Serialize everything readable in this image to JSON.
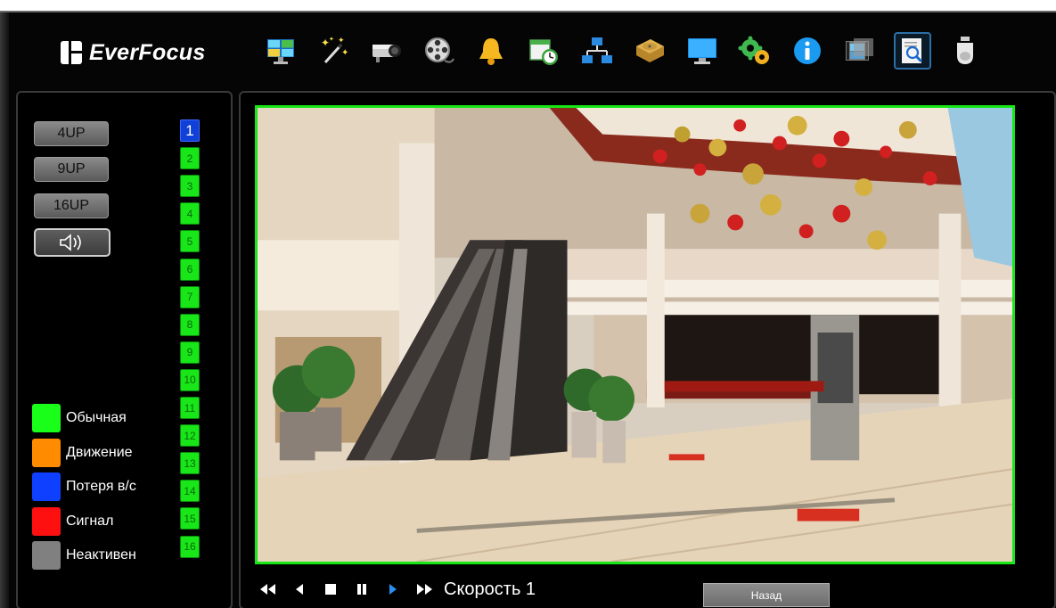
{
  "brand": {
    "name": "EverFocus"
  },
  "toolbar": {
    "icons": [
      {
        "name": "live-view-icon"
      },
      {
        "name": "wizard-icon"
      },
      {
        "name": "camera-icon"
      },
      {
        "name": "record-reel-icon"
      },
      {
        "name": "alarm-bell-icon"
      },
      {
        "name": "schedule-icon"
      },
      {
        "name": "network-icon"
      },
      {
        "name": "hdd-icon"
      },
      {
        "name": "display-icon"
      },
      {
        "name": "system-settings-icon"
      },
      {
        "name": "info-icon"
      },
      {
        "name": "playback-icon"
      },
      {
        "name": "search-icon",
        "active": true
      },
      {
        "name": "ptz-dome-icon"
      }
    ]
  },
  "layouts": {
    "btn_4": "4UP",
    "btn_9": "9UP",
    "btn_16": "16UP"
  },
  "channels": [
    "1",
    "2",
    "3",
    "4",
    "5",
    "6",
    "7",
    "8",
    "9",
    "10",
    "11",
    "12",
    "13",
    "14",
    "15",
    "16"
  ],
  "selected_channel": "1",
  "legend": [
    {
      "label": "Обычная",
      "color": "#19ff19"
    },
    {
      "label": "Движение",
      "color": "#ff8c00"
    },
    {
      "label": "Потеря в/с",
      "color": "#1040ff"
    },
    {
      "label": "Сигнал",
      "color": "#ff1010"
    },
    {
      "label": "Неактивен",
      "color": "#808080"
    }
  ],
  "playback": {
    "speed_label": "Скорость 1",
    "back_label": "Назад"
  },
  "colors": {
    "active_border": "#17e617",
    "channel_green": "#19e619",
    "channel_selected": "#1040d8"
  }
}
